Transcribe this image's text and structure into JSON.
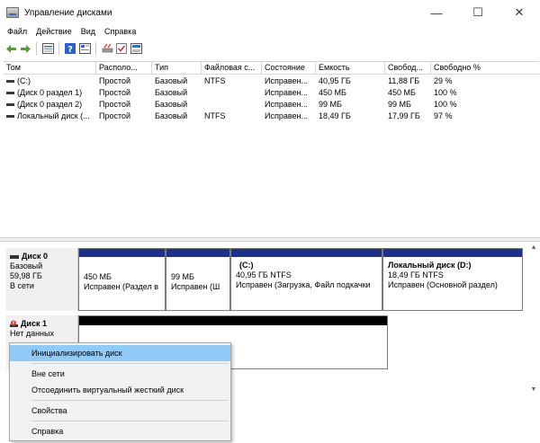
{
  "window": {
    "title": "Управление дисками",
    "minimize": "—",
    "maximize": "☐",
    "close": "✕"
  },
  "menu": [
    "Файл",
    "Действие",
    "Вид",
    "Справка"
  ],
  "toolbar": [
    "back-icon",
    "forward-icon",
    "list-view-icon",
    "help-icon",
    "properties-icon",
    "connect-icon",
    "check-icon",
    "layout-icon"
  ],
  "table": {
    "columns": [
      "Том",
      "Располо...",
      "Тип",
      "Файловая с...",
      "Состояние",
      "Емкость",
      "Свобод...",
      "Свободно %"
    ],
    "rows": [
      [
        "(C:)",
        "Простой",
        "Базовый",
        "NTFS",
        "Исправен...",
        "40,95 ГБ",
        "11,88 ГБ",
        "29 %"
      ],
      [
        "(Диск 0 раздел 1)",
        "Простой",
        "Базовый",
        "",
        "Исправен...",
        "450 МБ",
        "450 МБ",
        "100 %"
      ],
      [
        "(Диск 0 раздел 2)",
        "Простой",
        "Базовый",
        "",
        "Исправен...",
        "99 МБ",
        "99 МБ",
        "100 %"
      ],
      [
        "Локальный диск (...",
        "Простой",
        "Базовый",
        "NTFS",
        "Исправен...",
        "18,49 ГБ",
        "17,99 ГБ",
        "97 %"
      ]
    ]
  },
  "disk0": {
    "name": "Диск 0",
    "type": "Базовый",
    "size": "59,98 ГБ",
    "status": "В сети",
    "partitions": [
      {
        "title": "",
        "line1": "450 МБ",
        "line2": "Исправен (Раздел в"
      },
      {
        "title": "",
        "line1": "99 МБ",
        "line2": "Исправен (Ш"
      },
      {
        "title": "(C:)",
        "line1": "40,95 ГБ NTFS",
        "line2": "Исправен (Загрузка, Файл подкачки"
      },
      {
        "title": "Локальный диск  (D:)",
        "line1": "18,49 ГБ NTFS",
        "line2": "Исправен (Основной раздел)"
      }
    ]
  },
  "disk1": {
    "name": "Диск 1",
    "status": "Нет данных"
  },
  "context_menu": [
    "Инициализировать диск",
    "Вне сети",
    "Отсоединить виртуальный жесткий диск",
    "Свойства",
    "Справка"
  ],
  "colors": {
    "partition_bar": "#1e2f8c",
    "unallocated_bar": "#000000",
    "highlight": "#91c9f7"
  }
}
